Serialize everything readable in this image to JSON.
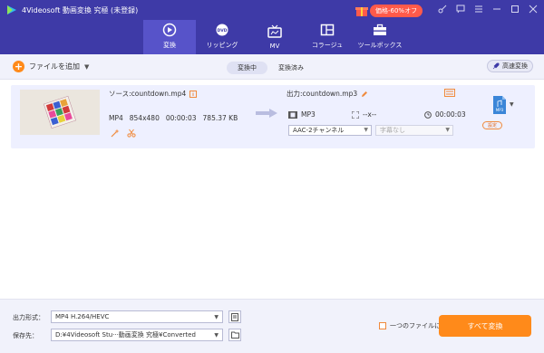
{
  "window": {
    "title": "4Videosoft 動画変換 究極 (未登録)",
    "promo": "価格-60%オフ"
  },
  "tabs": [
    {
      "label": "変換",
      "active": true
    },
    {
      "label": "リッピング"
    },
    {
      "label": "MV"
    },
    {
      "label": "コラージュ"
    },
    {
      "label": "ツールボックス"
    }
  ],
  "toolbar": {
    "add_file": "ファイルを追加",
    "seg_converting": "変換中",
    "seg_converted": "変換済み",
    "fast_convert": "高速変換"
  },
  "file": {
    "source": "ソース:countdown.mp4",
    "format": "MP4",
    "resolution": "854x480",
    "duration": "00:00:03",
    "size": "785.37 KB",
    "output": "出力:countdown.mp3",
    "out_format": "MP3",
    "out_resolution": "--x--",
    "out_duration": "00:00:03",
    "audio_track": "AAC-2チャンネル",
    "subtitle": "字幕なし",
    "fmt_icon_label": "MP3",
    "settings_label": "設定"
  },
  "bottom": {
    "format_label": "出力形式：",
    "format_value": "MP4 H.264/HEVC",
    "save_label": "保存先：",
    "save_value": "D:¥4Videosoft Stu···動画変換 究極¥Converted",
    "merge_label": "一つのファイルに結合",
    "convert_all": "すべて変換"
  },
  "colors": {
    "accent": "#3e3aa7",
    "orange": "#ff8a1a"
  }
}
